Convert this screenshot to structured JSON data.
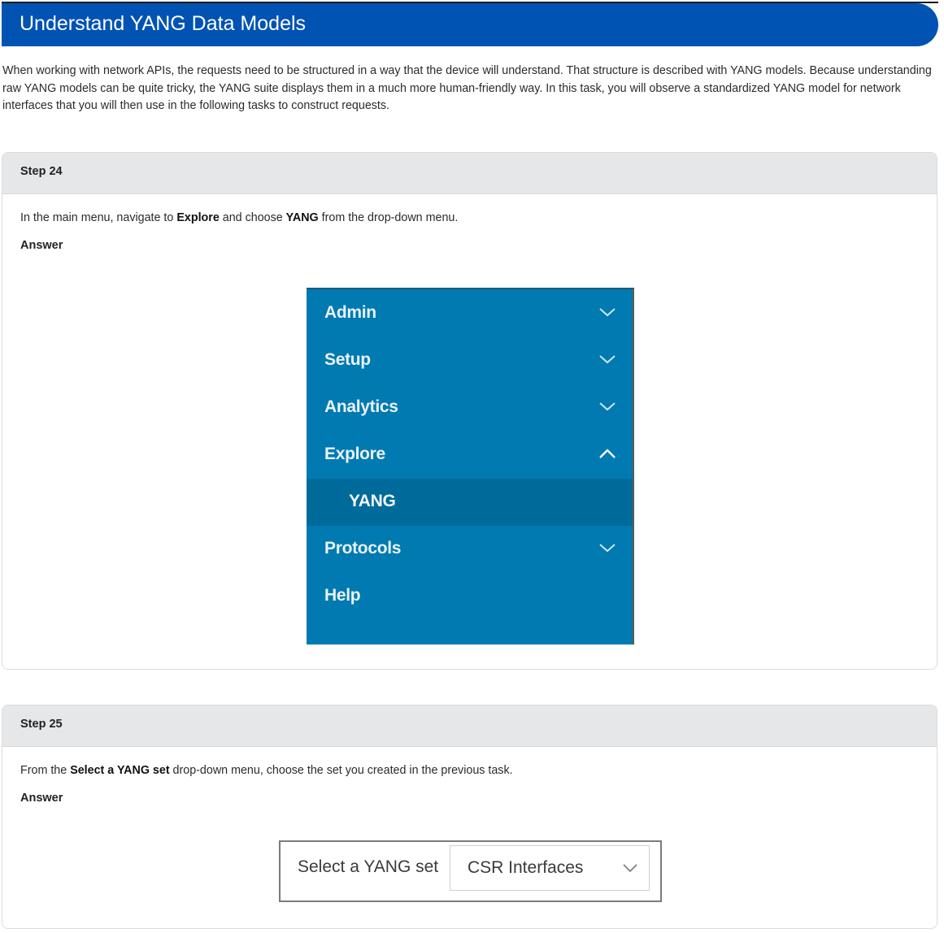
{
  "header": {
    "title": "Understand YANG Data Models"
  },
  "intro": "When working with network APIs, the requests need to be structured in a way that the device will understand. That structure is described with YANG models. Because understanding raw YANG models can be quite tricky, the YANG suite displays them in a much more human-friendly way. In this task, you will observe a standardized YANG model for network interfaces that you will then use in the following tasks to construct requests.",
  "step24": {
    "title": "Step 24",
    "text_a": "In the main menu, navigate to ",
    "bold_a": "Explore",
    "text_b": " and choose ",
    "bold_b": "YANG",
    "text_c": " from the drop-down menu.",
    "answer": "Answer",
    "menu": {
      "admin": "Admin",
      "setup": "Setup",
      "analytics": "Analytics",
      "explore": "Explore",
      "yang": "YANG",
      "protocols": "Protocols",
      "help": "Help"
    }
  },
  "step25": {
    "title": "Step 25",
    "text_a": "From the ",
    "bold_a": "Select a YANG set",
    "text_b": " drop-down menu, choose the set you created in the previous task.",
    "answer": "Answer",
    "select_label": "Select a YANG set",
    "select_value": "CSR Interfaces"
  },
  "colors": {
    "banner": "#0053b2",
    "menu_bg": "#007ab0",
    "menu_selected": "#006b9b"
  }
}
